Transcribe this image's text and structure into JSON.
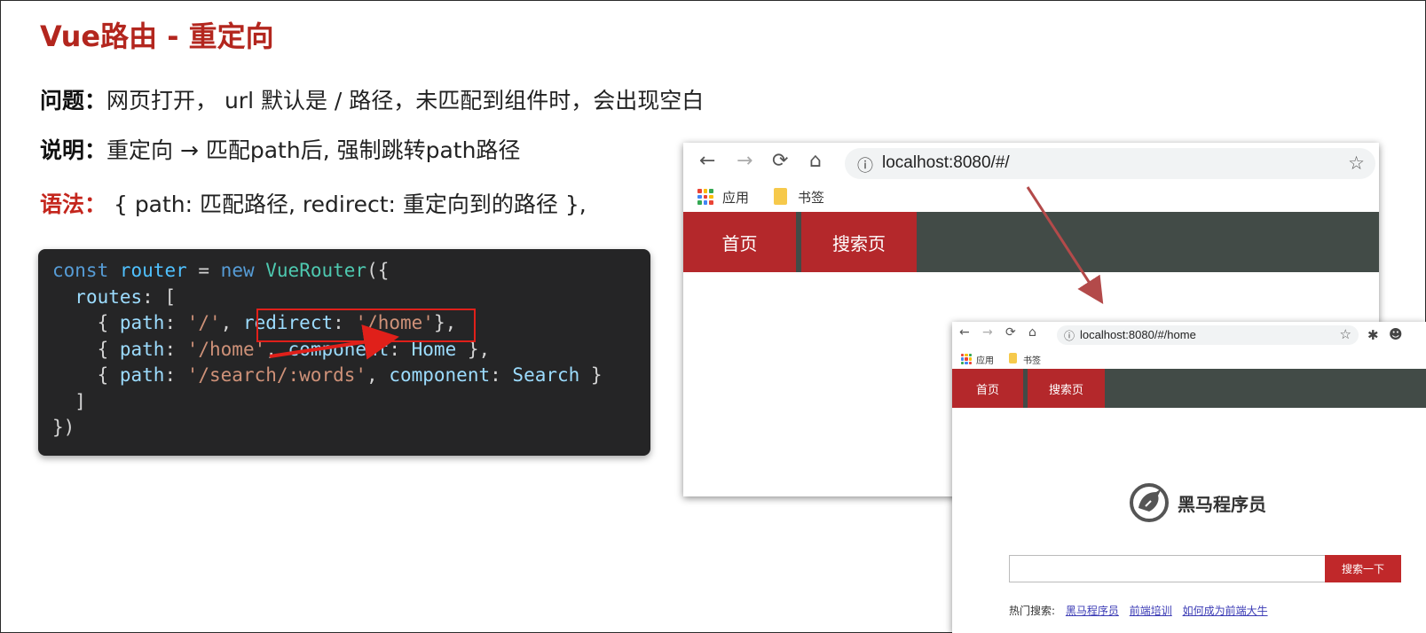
{
  "slide": {
    "title": "Vue路由 - 重定向",
    "problem": {
      "label": "问题：",
      "text": "网页打开， url 默认是 / 路径，未匹配到组件时，会出现空白"
    },
    "explain": {
      "label": "说明：",
      "text": "重定向 → 匹配path后, 强制跳转path路径"
    },
    "syntax": {
      "label": "语法：",
      "text": " { path: 匹配路径, redirect: 重定向到的路径 },"
    }
  },
  "code": {
    "l1": {
      "kw": "const",
      "var": "router",
      "eq": " = ",
      "new": "new",
      "cls": "VueRouter",
      "end": "({"
    },
    "l2": {
      "indent": "  ",
      "prop": "routes",
      "end": ": ["
    },
    "l3": {
      "indent": "    { ",
      "prop": "path",
      "colon": ": ",
      "str": "'/'",
      "comma": ", ",
      "prop2": "redirect",
      "colon2": ": ",
      "str2": "'/home'",
      "end": "},"
    },
    "l4": {
      "indent": "    { ",
      "prop": "path",
      "colon": ": ",
      "str": "'/home'",
      "comma": ", ",
      "prop2": "component",
      "colon2": ": ",
      "ty": "Home",
      "end": " },"
    },
    "l5": {
      "indent": "    { ",
      "prop": "path",
      "colon": ": ",
      "str": "'/search/:words'",
      "comma": ", ",
      "prop2": "component",
      "colon2": ": ",
      "ty": "Search",
      "end": " }"
    },
    "l6": {
      "text": "  ]"
    },
    "l7": {
      "text": "})"
    }
  },
  "browser1": {
    "url": "localhost:8080/#/",
    "bookmarks": {
      "apps": "应用",
      "folder": "书签"
    },
    "tabs": [
      "首页",
      "搜索页"
    ]
  },
  "browser2": {
    "url": "localhost:8080/#/home",
    "bookmarks": {
      "apps": "应用",
      "folder": "书签"
    },
    "tabs": [
      "首页",
      "搜索页"
    ],
    "logo_text": "黑马程序员",
    "search_button": "搜索一下",
    "hot_label": "热门搜索:",
    "hot_links": [
      "黑马程序员",
      "前端培训",
      "如何成为前端大牛"
    ]
  },
  "icons": {
    "back": "←",
    "forward": "→",
    "reload": "⟳",
    "home": "⌂",
    "info": "ⓘ",
    "star": "☆",
    "extensions": "✱",
    "account": "☻"
  },
  "colors": {
    "title_red": "#b3261e",
    "tab_red": "#b4282b",
    "navbar": "#424b47",
    "code_bg": "#252526",
    "highlight_box": "#e0201a",
    "arrow": "#e0201a",
    "diag_arrow": "#b34a4a"
  }
}
